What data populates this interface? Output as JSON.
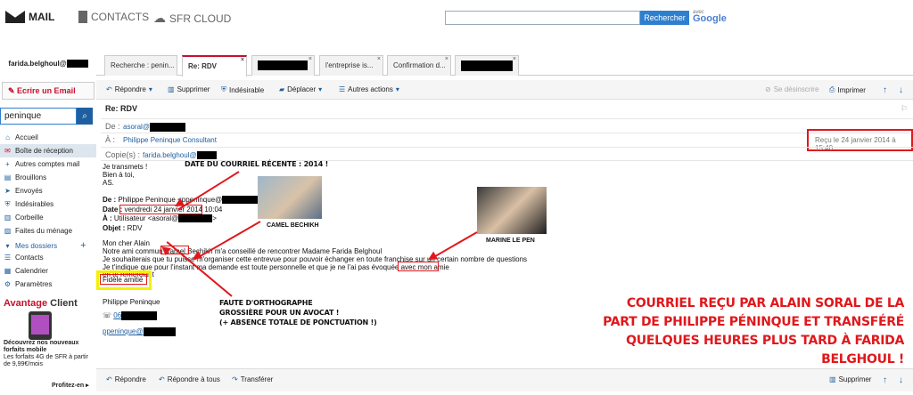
{
  "header": {
    "mail": "MAIL",
    "contacts": "CONTACTS",
    "cloud": "SFR CLOUD",
    "search_button": "Rechercher",
    "google_avec": "avec",
    "google_brand": "Google"
  },
  "sidebar": {
    "user": "farida.belghoul@",
    "compose": "Ecrire un Email",
    "search_value": "peninque",
    "items": [
      {
        "label": "Accueil",
        "icon": "home-icon"
      },
      {
        "label": "Boîte de réception",
        "icon": "inbox-icon"
      },
      {
        "label": "Autres comptes mail",
        "icon": "plus-icon"
      },
      {
        "label": "Brouillons",
        "icon": "draft-icon"
      },
      {
        "label": "Envoyés",
        "icon": "sent-icon"
      },
      {
        "label": "Indésirables",
        "icon": "shield-icon"
      },
      {
        "label": "Corbeille",
        "icon": "trash-icon"
      },
      {
        "label": "Faites du ménage",
        "icon": "broom-icon"
      },
      {
        "label": "Mes dossiers",
        "icon": "folder-icon"
      },
      {
        "label": "Contacts",
        "icon": "contacts-icon"
      },
      {
        "label": "Calendrier",
        "icon": "calendar-icon"
      },
      {
        "label": "Paramètres",
        "icon": "gear-icon"
      }
    ],
    "adv_title_red": "Avantage",
    "adv_title_dark": "Client",
    "adv_bold": "Découvrez nos nouveaux forfaits mobile",
    "adv_text": "Les forfaits 4G de SFR à partir de 9,99€/mois",
    "adv_link": "Profitez-en"
  },
  "tabs": [
    {
      "label": "Recherche : penin..."
    },
    {
      "label": "Re: RDV"
    },
    {
      "label": ""
    },
    {
      "label": "l'entreprise is..."
    },
    {
      "label": "Confirmation d..."
    },
    {
      "label": ""
    }
  ],
  "toolbar": {
    "reply": "Répondre",
    "delete": "Supprimer",
    "spam": "Indésirable",
    "move": "Déplacer",
    "other": "Autres actions",
    "unsubscribe": "Se désinscrire",
    "print": "Imprimer"
  },
  "message": {
    "subject": "Re: RDV",
    "from_label": "De :",
    "from": "asoral@",
    "to_label": "À :",
    "to": "Philippe Peninque Consultant",
    "cc_label": "Copie(s) :",
    "cc": "farida.belghoul@",
    "received": "Reçu le 24 janvier 2014 à 15:40",
    "fwd_lines": [
      "Je transmets !",
      "Bien à toi,",
      "AS."
    ],
    "orig_from_label": "De :",
    "orig_from": "Philippe Peninque",
    "orig_from_email": "<ppeninque@",
    "orig_date_label": "Date :",
    "orig_date": "vendredi 24 janvier 2014",
    "orig_time": "10:04",
    "orig_to_label": "À :",
    "orig_to": "Utilisateur <asoral@",
    "orig_subject_label": "Objet :",
    "orig_subject": "RDV",
    "greeting": "Mon cher Alain",
    "body_lines": [
      "Notre ami commun Camel Bechikh m'a conseillé de rencontrer Madame Farida Belghoul",
      "Je souhaiterais que tu puisse m'organiser cette entrevue pour pouvoir échanger en toute franchise sur un certain nombre de questions",
      "Je t'indique que pour l'instant ma demande est toute personnelle et que je ne l'ai pas évoquée avec mon amie",
      "en te remerciant"
    ],
    "closing": "Fidèle amitié",
    "signature": "Philippe Peninque",
    "phone": "06",
    "email": "ppeninque@"
  },
  "annotations": {
    "date_note": "DATE DU COURRIEL RÉCENTE : 2014 !",
    "camel": "CAMEL BECHIKH",
    "lepen": "MARINE LE PEN",
    "faute_1": "FAUTE D'ORTHOGRAPHE",
    "faute_2": "GROSSIÈRE POUR UN AVOCAT !",
    "faute_3": "(+ ABSENCE TOTALE DE PONCTUATION !)",
    "big_1": "COURRIEL REÇU PAR ALAIN SORAL DE LA",
    "big_2": "PART DE PHILIPPE PÉNINQUE ET TRANSFÉRÉ",
    "big_3": "QUELQUES HEURES PLUS TARD À FARIDA BELGHOUL !"
  },
  "bottom": {
    "reply": "Répondre",
    "reply_all": "Répondre à tous",
    "forward": "Transférer",
    "delete": "Supprimer"
  },
  "colors": {
    "accent_red": "#e0181c",
    "brand_blue": "#1f5f9f"
  }
}
